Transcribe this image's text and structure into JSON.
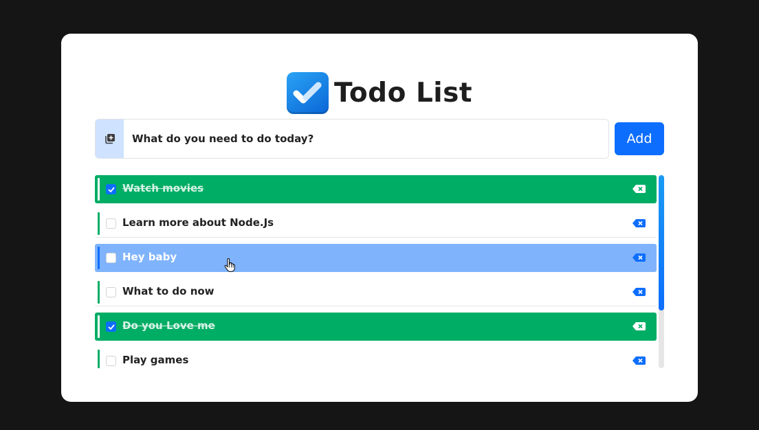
{
  "app": {
    "title": "Todo List",
    "logo_icon": "checklist-check-icon"
  },
  "input": {
    "placeholder": "What do you need to do today?",
    "value": "",
    "prefix_icon": "add-to-collection-icon"
  },
  "add_button": {
    "label": "Add"
  },
  "todos": [
    {
      "text": "Watch movies",
      "completed": true,
      "state": "done"
    },
    {
      "text": "Learn more about Node.Js",
      "completed": false,
      "state": "normal"
    },
    {
      "text": "Hey baby",
      "completed": false,
      "state": "hover"
    },
    {
      "text": "What to do now",
      "completed": false,
      "state": "normal"
    },
    {
      "text": "Do you Love me",
      "completed": true,
      "state": "done"
    },
    {
      "text": "Play games",
      "completed": false,
      "state": "normal"
    }
  ],
  "delete_icon": "backspace-delete-icon",
  "colors": {
    "background": "#151515",
    "card": "#ffffff",
    "primary": "#0d6efd",
    "done": "#00ad64",
    "hover": "#7fb3fc",
    "prefix_bg": "#cfe2ff"
  },
  "scroll": {
    "position_fraction": 0.0,
    "visible_fraction": 0.7
  }
}
